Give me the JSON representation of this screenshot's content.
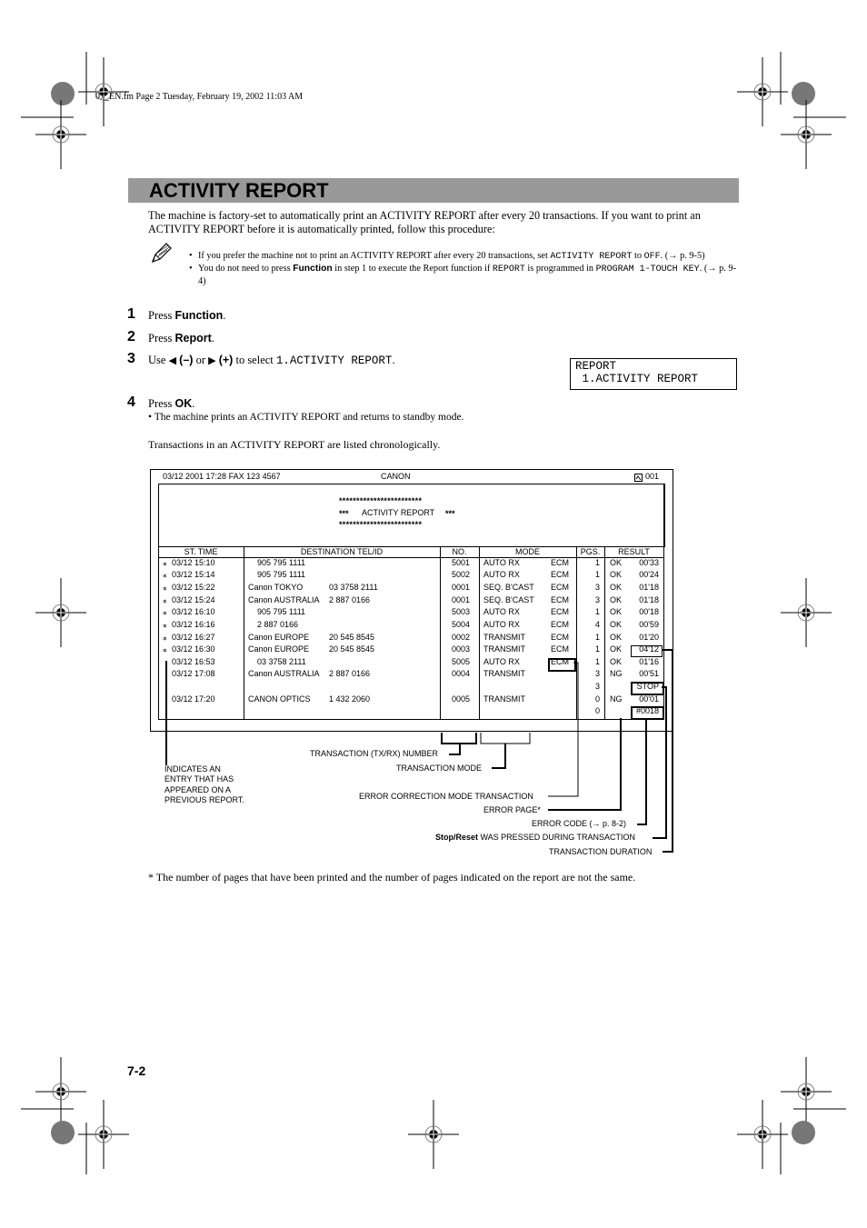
{
  "page_header": "07_EN.fm  Page 2  Tuesday, February 19, 2002  11:03 AM",
  "section_title": "ACTIVITY REPORT",
  "intro": "The machine is factory-set to automatically print an ACTIVITY REPORT after every 20 transactions. If you want to print an ACTIVITY REPORT before it is automatically printed, follow this procedure:",
  "notes": [
    {
      "pre": "If you prefer the machine not to print an ACTIVITY REPORT after every 20 transactions, set ",
      "code1": "ACTIVITY REPORT",
      "mid": " to ",
      "code2": "OFF",
      "post": ". (→ p. 9-5)"
    },
    {
      "pre": "You do not need to press ",
      "bold": "Function",
      "mid": " in step 1 to execute the Report function if ",
      "code1": "REPORT",
      "mid2": " is programmed in ",
      "code2": "PROGRAM 1-TOUCH KEY",
      "post": ". (→ p. 9-4)"
    }
  ],
  "steps": [
    {
      "num": "1",
      "pre": "Press ",
      "key": "Function",
      "post": "."
    },
    {
      "num": "2",
      "pre": "Press ",
      "key": "Report",
      "post": "."
    },
    {
      "num": "3",
      "pre": "Use ",
      "left_arrow": "◀",
      "minus": "(–)",
      "or": " or ",
      "right_arrow": "▶",
      "plus": "(+)",
      "mid": " to select ",
      "code": "1.ACTIVITY REPORT",
      "post": "."
    },
    {
      "num": "4",
      "pre": "Press ",
      "key": "OK",
      "post": ".",
      "sub": "• The machine prints an ACTIVITY REPORT and returns to standby mode."
    }
  ],
  "lcd": {
    "line1": "REPORT",
    "line2": " 1.ACTIVITY REPORT"
  },
  "chrono_text": "Transactions in an ACTIVITY REPORT are listed chronologically.",
  "report": {
    "header_left": "03/12 2001 17:28 FAX 123 4567",
    "header_center": "CANON",
    "header_right": "001",
    "stars": "************************",
    "title_stars": "***",
    "title": "ACTIVITY REPORT",
    "columns": [
      "ST. TIME",
      "DESTINATION TEL/ID",
      "NO.",
      "MODE",
      "PGS.",
      "RESULT"
    ],
    "rows": [
      {
        "star": "⁎",
        "time": "03/12 15:10",
        "dest": "905 795 1111",
        "dest_num": "",
        "no": "5001",
        "mode": "AUTO RX",
        "ecm": "ECM",
        "pgs": "1",
        "res": "OK",
        "dur": "00'33"
      },
      {
        "star": "⁎",
        "time": "03/12 15:14",
        "dest": "905 795 1111",
        "dest_num": "",
        "no": "5002",
        "mode": "AUTO RX",
        "ecm": "ECM",
        "pgs": "1",
        "res": "OK",
        "dur": "00'24"
      },
      {
        "star": "⁎",
        "time": "03/12 15:22",
        "dest": "Canon TOKYO",
        "dest_num": "03 3758 2111",
        "no": "0001",
        "mode": "SEQ. B'CAST",
        "ecm": "ECM",
        "pgs": "3",
        "res": "OK",
        "dur": "01'18"
      },
      {
        "star": "⁎",
        "time": "03/12 15:24",
        "dest": "Canon AUSTRALIA",
        "dest_num": "2 887 0166",
        "no": "0001",
        "mode": "SEQ. B'CAST",
        "ecm": "ECM",
        "pgs": "3",
        "res": "OK",
        "dur": "01'18"
      },
      {
        "star": "⁎",
        "time": "03/12 16:10",
        "dest": "905 795 1111",
        "dest_num": "",
        "no": "5003",
        "mode": "AUTO RX",
        "ecm": "ECM",
        "pgs": "1",
        "res": "OK",
        "dur": "00'18"
      },
      {
        "star": "⁎",
        "time": "03/12 16:16",
        "dest": "2 887 0166",
        "dest_num": "",
        "no": "5004",
        "mode": "AUTO RX",
        "ecm": "ECM",
        "pgs": "4",
        "res": "OK",
        "dur": "00'59"
      },
      {
        "star": "⁎",
        "time": "03/12 16:27",
        "dest": "Canon EUROPE",
        "dest_num": "20 545 8545",
        "no": "0002",
        "mode": "TRANSMIT",
        "ecm": "ECM",
        "pgs": "1",
        "res": "OK",
        "dur": "01'20"
      },
      {
        "star": "⁎",
        "time": "03/12 16:30",
        "dest": "Canon EUROPE",
        "dest_num": "20 545 8545",
        "no": "0003",
        "mode": "TRANSMIT",
        "ecm": "ECM",
        "pgs": "1",
        "res": "OK",
        "dur": "04'12"
      },
      {
        "star": "",
        "time": "03/12 16:53",
        "dest": "03 3758 2111",
        "dest_num": "",
        "no": "5005",
        "mode": "AUTO RX",
        "ecm": "ECM",
        "pgs": "1",
        "res": "OK",
        "dur": "01'16"
      },
      {
        "star": "",
        "time": "03/12 17:08",
        "dest": "Canon AUSTRALIA",
        "dest_num": "2 887 0166",
        "no": "0004",
        "mode": "TRANSMIT",
        "ecm": "",
        "pgs": "3",
        "res": "NG",
        "dur": "00'51"
      },
      {
        "star": "",
        "time": "",
        "dest": "",
        "dest_num": "",
        "no": "",
        "mode": "",
        "ecm": "",
        "pgs": "3",
        "res": "",
        "dur": "STOP"
      },
      {
        "star": "",
        "time": "03/12 17:20",
        "dest": "CANON OPTICS",
        "dest_num": "1 432 2060",
        "no": "0005",
        "mode": "TRANSMIT",
        "ecm": "",
        "pgs": "0",
        "res": "NG",
        "dur": "00'01"
      },
      {
        "star": "",
        "time": "",
        "dest": "",
        "dest_num": "",
        "no": "",
        "mode": "",
        "ecm": "",
        "pgs": "0",
        "res": "",
        "dur": "#0018"
      }
    ]
  },
  "callouts": {
    "previous": [
      "INDICATES AN",
      "ENTRY THAT HAS",
      "APPEARED ON A",
      "PREVIOUS REPORT."
    ],
    "tx_number": "TRANSACTION (TX/RX) NUMBER",
    "tx_mode": "TRANSACTION MODE",
    "ecm": "ERROR CORRECTION MODE TRANSACTION",
    "error_page": "ERROR PAGE*",
    "error_code": "ERROR CODE (→ p. 8-2)",
    "stop_bold": "Stop/Reset",
    "stop_rest": " WAS PRESSED DURING TRANSACTION",
    "duration": "TRANSACTION DURATION"
  },
  "footnote": "*  The number of pages that have been printed and the number of pages indicated on the report are not the same.",
  "page_number": "7-2"
}
